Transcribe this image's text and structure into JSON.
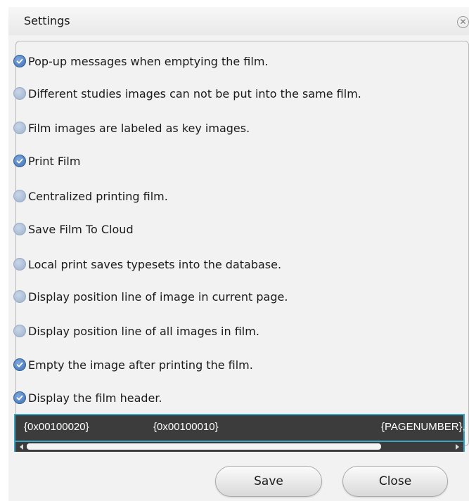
{
  "window": {
    "title": "Settings"
  },
  "options": [
    {
      "label": "Pop-up messages when emptying the film.",
      "checked": true
    },
    {
      "label": "Different studies images can not be put into the same film.",
      "checked": false
    },
    {
      "label": "Film images are labeled as key images.",
      "checked": false
    },
    {
      "label": "Print Film",
      "checked": true
    },
    {
      "label": "Centralized printing film.",
      "checked": false
    },
    {
      "label": "Save Film To Cloud",
      "checked": false
    },
    {
      "label": "Local print saves typesets into the database.",
      "checked": false
    },
    {
      "label": "Display position line of image in current page.",
      "checked": false
    },
    {
      "label": "Display position line of all images in film.",
      "checked": false
    },
    {
      "label": "Empty the image after printing the film.",
      "checked": true
    },
    {
      "label": "Display the film header.",
      "checked": true
    }
  ],
  "film_header": {
    "fields": [
      "{0x00100020}",
      "{0x00100010}",
      "{PAGENUMBER},"
    ],
    "scroll_position_fraction": 0.78
  },
  "buttons": {
    "save": "Save",
    "close": "Close"
  },
  "icons": {
    "close": "close-icon",
    "checked": "check-icon"
  },
  "colors": {
    "radio_checked": "#3d6fb3",
    "radio_unchecked": "#a8bbd3",
    "header_bg": "#3c3c3c",
    "header_border": "#3aa7c4"
  }
}
